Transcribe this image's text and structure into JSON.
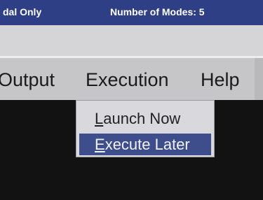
{
  "status_bar": {
    "left_text": "dal Only",
    "right_text": "Number of Modes: 5"
  },
  "menu_bar": {
    "items": [
      {
        "label": "Output"
      },
      {
        "label": "Execution"
      },
      {
        "label": "Help"
      }
    ]
  },
  "execution_menu": {
    "items": [
      {
        "mnemonic": "L",
        "rest": "aunch Now",
        "label": "Launch Now",
        "highlighted": false
      },
      {
        "mnemonic": "E",
        "rest": "xecute Later",
        "label": "Execute Later",
        "highlighted": true
      }
    ]
  },
  "colors": {
    "status_bar": "#2e3f86",
    "toolbar": "#d5d5d8",
    "menu_bar": "#c6c6c9",
    "workspace": "#121212",
    "highlight": "#3e4d8c"
  }
}
